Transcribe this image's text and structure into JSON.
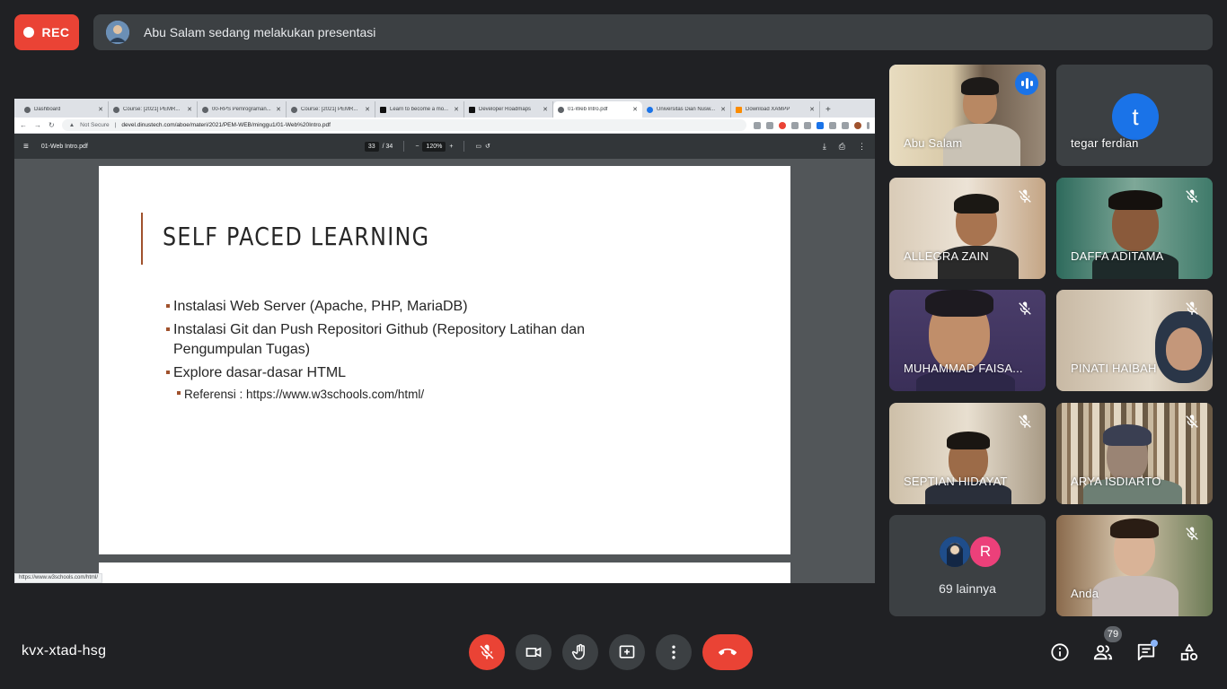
{
  "top": {
    "rec_label": "REC",
    "presenter_text": "Abu Salam sedang melakukan presentasi"
  },
  "screen_share": {
    "tabs": [
      {
        "label": "Dashboard"
      },
      {
        "label": "Course: [2021] PEMR..."
      },
      {
        "label": "00-RPS Pemrograman..."
      },
      {
        "label": "Course: [2021] PEMR..."
      },
      {
        "label": "Learn to become a mo..."
      },
      {
        "label": "Developer Roadmaps"
      },
      {
        "label": "01-Web Intro.pdf"
      },
      {
        "label": "Universitas Dian Nusw..."
      },
      {
        "label": "Download XAMPP"
      }
    ],
    "not_secure": "Not Secure",
    "url": "devel.dinustech.com/aboe/materi/2021/PEM-WEB/minggu1/01-Web%20Intro.pdf",
    "pdf_title": "01-Web Intro.pdf",
    "page_current": "33",
    "page_total": "/ 34",
    "zoom": "120%",
    "slide": {
      "title": "SELF PACED LEARNING",
      "bullets": [
        "Instalasi Web Server (Apache, PHP, MariaDB)",
        "Instalasi Git dan Push Repositori Github (Repository Latihan dan Pengumpulan Tugas)",
        "Explore dasar-dasar HTML"
      ],
      "sub_bullet": "Referensi : https://www.w3schools.com/html/"
    },
    "status_url": "https://www.w3schools.com/html/"
  },
  "participants": {
    "tiles": [
      {
        "name": "Abu Salam"
      },
      {
        "name": "tegar ferdian",
        "initial": "t"
      },
      {
        "name": "ALLEGRA ZAIN"
      },
      {
        "name": "DAFFA ADITAMA"
      },
      {
        "name": "MUHAMMAD FAISA..."
      },
      {
        "name": "PINATI HAIBAH"
      },
      {
        "name": "SEPTIAN HIDAYAT"
      },
      {
        "name": "ARYA ISDIARTO"
      },
      {
        "name": "Anda"
      }
    ],
    "more": {
      "initial": "R",
      "text": "69 lainnya"
    }
  },
  "bottom": {
    "meeting_code": "kvx-xtad-hsg",
    "people_count": "79"
  },
  "colors": {
    "rec_red": "#ea4335",
    "active_blue": "#8ab4f8",
    "bg": "#202124"
  }
}
